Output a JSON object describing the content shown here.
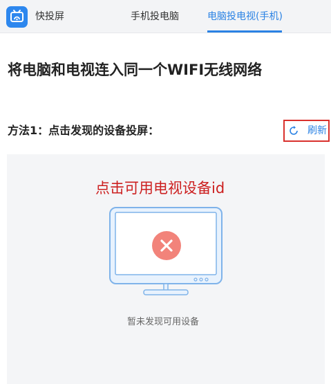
{
  "header": {
    "app_name": "快投屏",
    "tabs": [
      {
        "label": "手机投电脑",
        "active": false
      },
      {
        "label": "电脑投电视(手机)",
        "active": true
      }
    ]
  },
  "main": {
    "title": "将电脑和电视连入同一个WIFI无线网络",
    "method_title": "方法1：点击发现的设备投屏：",
    "refresh_label": "刷新",
    "annotation": "点击可用电视设备id",
    "empty_message": "暂未发现可用设备"
  },
  "colors": {
    "accent": "#2a82e4",
    "annotation_red": "#cc1f1f",
    "error_circle": "#f2837a",
    "panel_bg": "#f4f5f7"
  },
  "icons": {
    "app": "tv-cast-app-icon",
    "refresh": "refresh-icon",
    "monitor": "monitor-icon",
    "error": "close-icon"
  }
}
